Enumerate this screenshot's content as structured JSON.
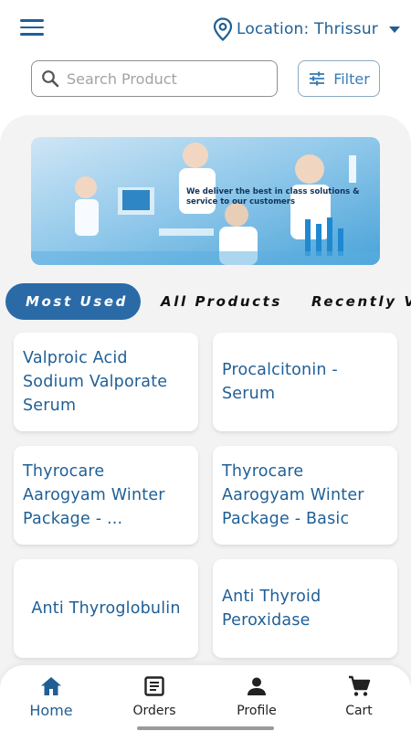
{
  "header": {
    "menu_icon": "hamburger-menu-icon",
    "location_icon": "location-pin-icon",
    "location_label": "Location: Thrissur",
    "dropdown_icon": "caret-down-icon"
  },
  "search": {
    "placeholder": "Search Product",
    "value": "",
    "icon": "search-icon"
  },
  "filter": {
    "label": "Filter",
    "icon": "sliders-icon"
  },
  "banner": {
    "text": "We deliver the best in class solutions & service to our customers"
  },
  "tabs": [
    {
      "label": "Most Used",
      "active": true
    },
    {
      "label": "All Products",
      "active": false
    },
    {
      "label": "Recently V",
      "active": false
    }
  ],
  "products": [
    {
      "name": "Valproic Acid Sodium Valporate Serum"
    },
    {
      "name": "Procalcitonin - Serum"
    },
    {
      "name": "Thyrocare Aarogyam  Winter Package - ..."
    },
    {
      "name": "Thyrocare Aarogyam  Winter Package - Basic"
    },
    {
      "name": "Anti Thyroglobulin"
    },
    {
      "name": "Anti Thyroid Peroxidase"
    }
  ],
  "bottom_nav": [
    {
      "label": "Home",
      "icon": "home-icon",
      "active": true
    },
    {
      "label": "Orders",
      "icon": "orders-icon",
      "active": false
    },
    {
      "label": "Profile",
      "icon": "profile-icon",
      "active": false
    },
    {
      "label": "Cart",
      "icon": "cart-icon",
      "active": false
    }
  ],
  "colors": {
    "primary": "#1f5f96",
    "active_tab": "#2a6aa7",
    "panel": "#f3f3f3"
  }
}
